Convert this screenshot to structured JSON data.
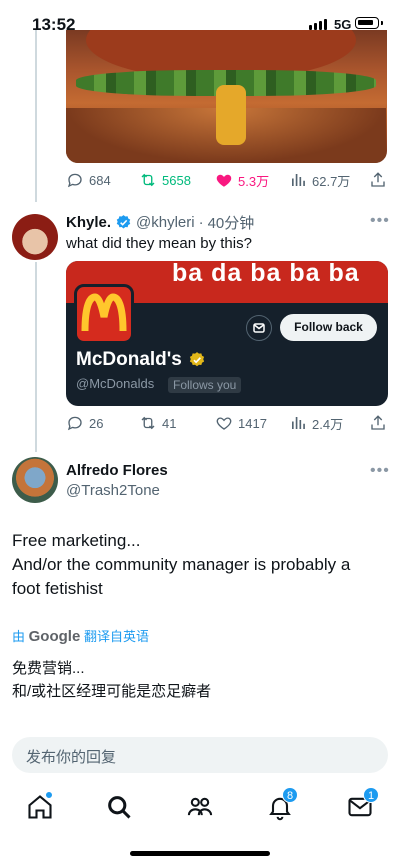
{
  "status": {
    "time": "13:52",
    "network": "5G"
  },
  "tweet_1": {
    "image_alt": "burger photo",
    "actions": {
      "replies": "684",
      "retweets": "5658",
      "likes": "5.3万",
      "views": "62.7万"
    },
    "colors": {
      "retweet_active": "#00ba7c",
      "like_active": "#f91880"
    }
  },
  "tweet_2": {
    "name": "Khyle.",
    "verified": true,
    "handle": "@khyleri",
    "dot": "·",
    "time": "40分钟",
    "text": "what did they mean by this?",
    "card": {
      "banner_text": "ba da ba ba ba",
      "name": "McDonald's",
      "handle": "@McDonalds",
      "follows_you": "Follows you",
      "follow_back": "Follow back",
      "logo_letter": "M"
    },
    "actions": {
      "replies": "26",
      "retweets": "41",
      "likes": "1417",
      "views": "2.4万"
    }
  },
  "main_tweet": {
    "name": "Alfredo Flores",
    "handle": "@Trash2Tone",
    "text_lines": [
      "Free marketing...",
      "And/or the community manager is probably a",
      "foot fetishist"
    ],
    "translate": {
      "prefix": "由",
      "brand": "Google",
      "suffix": "翻译自英语"
    },
    "translated_lines": [
      "免费营销...",
      "和/或社区经理可能是恋足癖者"
    ]
  },
  "reply": {
    "placeholder": "发布你的回复"
  },
  "tabs": {
    "home": "home-icon",
    "search": "search-icon",
    "communities": "communities-icon",
    "notifications": "notifications-icon",
    "notifications_badge": "8",
    "messages": "messages-icon",
    "messages_badge": "1"
  },
  "accent": "#1d9bf0"
}
